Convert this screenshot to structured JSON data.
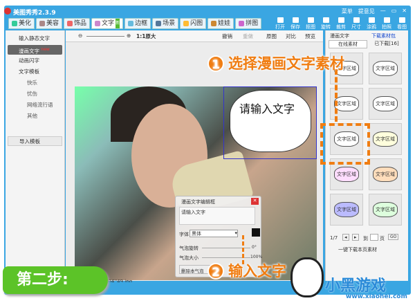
{
  "app": {
    "title": "美图秀秀2.3.9",
    "menu": "菜单",
    "feedback": "提意见",
    "controls": [
      "—",
      "▭",
      "✕"
    ]
  },
  "tabs": [
    {
      "label": "美化",
      "color": "#3c9"
    },
    {
      "label": "美容",
      "color": "#a88"
    },
    {
      "label": "饰品",
      "color": "#e66"
    },
    {
      "label": "文字",
      "color": "#c8c",
      "badge": "新",
      "active": true
    },
    {
      "label": "边框",
      "color": "#6bd"
    },
    {
      "label": "场景",
      "color": "#579"
    },
    {
      "label": "闪图",
      "color": "#fb3"
    },
    {
      "label": "娃娃",
      "color": "#c83"
    },
    {
      "label": "拼图",
      "color": "#c6c"
    }
  ],
  "tools": [
    "打开",
    "保存",
    "抠图",
    "旋转",
    "裁剪",
    "尺寸",
    "涂鸦",
    "拍照",
    "看图"
  ],
  "left": {
    "items": [
      "输入静态文字",
      "漫画文字",
      "动画闪字"
    ],
    "new_badge": "new",
    "template": "文字模板",
    "subs": [
      "快乐",
      "忧伤",
      "网络流行语",
      "其他"
    ],
    "import": "导入模板"
  },
  "toolbar": {
    "zoom": "1:1原大",
    "undo": "撤销",
    "redo": "重做",
    "original": "原图",
    "compare": "对比",
    "preview": "预览"
  },
  "bubble_text": "请输入文字",
  "dialog": {
    "title": "漫画文字编辑框",
    "text": "请输入文字",
    "font_label": "字体",
    "font_value": "黑体",
    "rotate_label": "气泡旋转",
    "rotate_value": "0°",
    "size_label": "气泡大小",
    "size_value": "100%",
    "delete": "删除本气泡"
  },
  "right": {
    "title": "漫画文字",
    "download": "下载素材包",
    "tab_online": "在线素材",
    "tab_downloaded": "已下载[16]",
    "item_label": "文字区域",
    "page": "1/7",
    "goto": "到",
    "page_unit": "页",
    "go": "GO",
    "download_page": "一键下载本页素材"
  },
  "filename": "8'04''49.jpg",
  "annotations": {
    "step1_num": "1",
    "step1": "选择漫画文字素材",
    "step2_num": "2",
    "step2": "输入文字",
    "step": "第二步:"
  },
  "brand": {
    "name": "小黑游戏",
    "url": "www.xiaohei.com"
  }
}
